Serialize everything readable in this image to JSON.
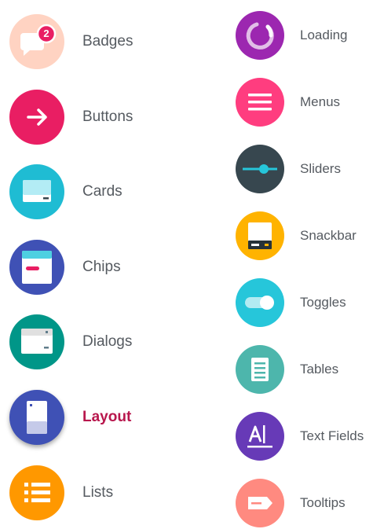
{
  "left_items": [
    {
      "label": "Badges",
      "icon": "badge-icon",
      "color": "#ffd3c2",
      "badge": "2",
      "badge_color": "#e91e63"
    },
    {
      "label": "Buttons",
      "icon": "arrow-right-icon",
      "color": "#e91e63"
    },
    {
      "label": "Cards",
      "icon": "card-icon",
      "color": "#1fbcd3"
    },
    {
      "label": "Chips",
      "icon": "chip-icon",
      "color": "#3f51b5"
    },
    {
      "label": "Dialogs",
      "icon": "dialog-icon",
      "color": "#009688"
    },
    {
      "label": "Layout",
      "icon": "layout-icon",
      "color": "#3f51b5",
      "active": true,
      "active_color": "#b8174d"
    },
    {
      "label": "Lists",
      "icon": "list-icon",
      "color": "#ff9800"
    }
  ],
  "right_items": [
    {
      "label": "Loading",
      "icon": "loading-spinner-icon",
      "color": "#9c27b0"
    },
    {
      "label": "Menus",
      "icon": "menu-icon",
      "color": "#ff3d7f"
    },
    {
      "label": "Sliders",
      "icon": "slider-icon",
      "color": "#37474f"
    },
    {
      "label": "Snackbar",
      "icon": "snackbar-icon",
      "color": "#ffb300"
    },
    {
      "label": "Toggles",
      "icon": "toggle-icon",
      "color": "#26c6da"
    },
    {
      "label": "Tables",
      "icon": "table-icon",
      "color": "#4db6ac"
    },
    {
      "label": "Text Fields",
      "icon": "text-field-icon",
      "color": "#673ab7"
    },
    {
      "label": "Tooltips",
      "icon": "tooltip-icon",
      "color": "#ff8a80"
    }
  ]
}
